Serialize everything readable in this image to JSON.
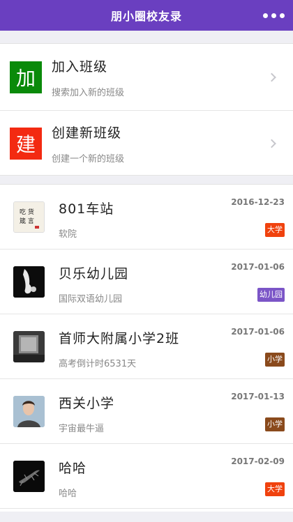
{
  "header": {
    "title": "朋小圈校友录",
    "more_icon": "more-dots-icon"
  },
  "actions": [
    {
      "icon_char": "加",
      "icon_color": "#0a8a0a",
      "title": "加入班级",
      "subtitle": "搜索加入新的班级"
    },
    {
      "icon_char": "建",
      "icon_color": "#f32a11",
      "title": "创建新班级",
      "subtitle": "创建一个新的班级"
    }
  ],
  "classes": [
    {
      "name": "801车站",
      "desc": "软院",
      "date": "2016-12-23",
      "badge": "大学",
      "badge_color": "#f0420e",
      "avatar_text": "吃 货\n箴 言"
    },
    {
      "name": "贝乐幼儿园",
      "desc": "国际双语幼儿园",
      "date": "2017-01-06",
      "badge": "幼儿园",
      "badge_color": "#7b55c7"
    },
    {
      "name": "首师大附属小学2班",
      "desc": "高考倒计时6531天",
      "date": "2017-01-06",
      "badge": "小学",
      "badge_color": "#8a4a1c"
    },
    {
      "name": "西关小学",
      "desc": "宇宙最牛逼",
      "date": "2017-01-13",
      "badge": "小学",
      "badge_color": "#8a4a1c"
    },
    {
      "name": "哈哈",
      "desc": "哈哈",
      "date": "2017-02-09",
      "badge": "大学",
      "badge_color": "#f0420e"
    }
  ]
}
